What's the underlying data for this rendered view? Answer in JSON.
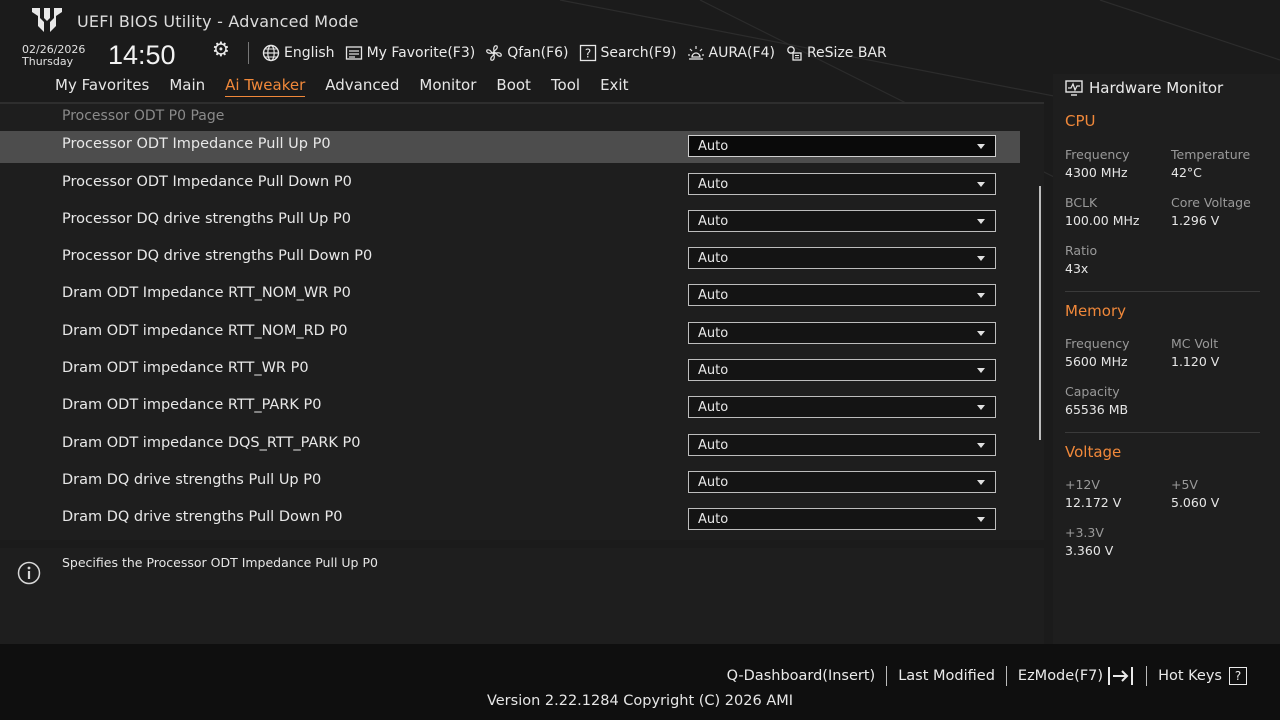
{
  "header": {
    "title": "UEFI BIOS Utility - Advanced Mode",
    "date": "02/26/2026",
    "day": "Thursday",
    "time": "14:50"
  },
  "toolbar": {
    "language": "English",
    "favorite": "My Favorite(F3)",
    "qfan": "Qfan(F6)",
    "search": "Search(F9)",
    "aura": "AURA(F4)",
    "resize_bar": "ReSize BAR"
  },
  "nav": {
    "tabs": [
      "My Favorites",
      "Main",
      "Ai Tweaker",
      "Advanced",
      "Monitor",
      "Boot",
      "Tool",
      "Exit"
    ],
    "active": "Ai Tweaker"
  },
  "page": {
    "heading": "Processor ODT P0 Page",
    "settings": [
      {
        "label": "Processor ODT Impedance Pull Up P0",
        "value": "Auto"
      },
      {
        "label": "Processor ODT Impedance Pull Down P0",
        "value": "Auto"
      },
      {
        "label": "Processor DQ drive strengths Pull Up P0",
        "value": "Auto"
      },
      {
        "label": "Processor DQ drive strengths Pull Down P0",
        "value": "Auto"
      },
      {
        "label": "Dram ODT Impedance RTT_NOM_WR P0",
        "value": "Auto"
      },
      {
        "label": "Dram ODT impedance RTT_NOM_RD P0",
        "value": "Auto"
      },
      {
        "label": "Dram ODT impedance RTT_WR P0",
        "value": "Auto"
      },
      {
        "label": "Dram ODT impedance RTT_PARK P0",
        "value": "Auto"
      },
      {
        "label": "Dram ODT impedance DQS_RTT_PARK P0",
        "value": "Auto"
      },
      {
        "label": "Dram DQ drive strengths Pull Up P0",
        "value": "Auto"
      },
      {
        "label": "Dram DQ drive strengths Pull Down P0",
        "value": "Auto"
      }
    ],
    "help": "Specifies the Processor ODT Impedance Pull Up P0"
  },
  "hw": {
    "title": "Hardware Monitor",
    "cpu": {
      "section": "CPU",
      "freq_label": "Frequency",
      "freq": "4300 MHz",
      "temp_label": "Temperature",
      "temp": "42°C",
      "bclk_label": "BCLK",
      "bclk": "100.00 MHz",
      "vcore_label": "Core Voltage",
      "vcore": "1.296 V",
      "ratio_label": "Ratio",
      "ratio": "43x"
    },
    "memory": {
      "section": "Memory",
      "freq_label": "Frequency",
      "freq": "5600 MHz",
      "mcvolt_label": "MC Volt",
      "mcvolt": "1.120 V",
      "cap_label": "Capacity",
      "cap": "65536 MB"
    },
    "voltage": {
      "section": "Voltage",
      "v12_label": "+12V",
      "v12": "12.172 V",
      "v5_label": "+5V",
      "v5": "5.060 V",
      "v33_label": "+3.3V",
      "v33": "3.360 V"
    }
  },
  "footer": {
    "qdash": "Q-Dashboard(Insert)",
    "last": "Last Modified",
    "ezmode": "EzMode(F7)",
    "hotkeys": "Hot Keys",
    "hotkeys_glyph": "?",
    "version": "Version 2.22.1284 Copyright (C) 2026 AMI"
  },
  "colors": {
    "accent": "#f0883a",
    "background": "#1b1b1b"
  }
}
